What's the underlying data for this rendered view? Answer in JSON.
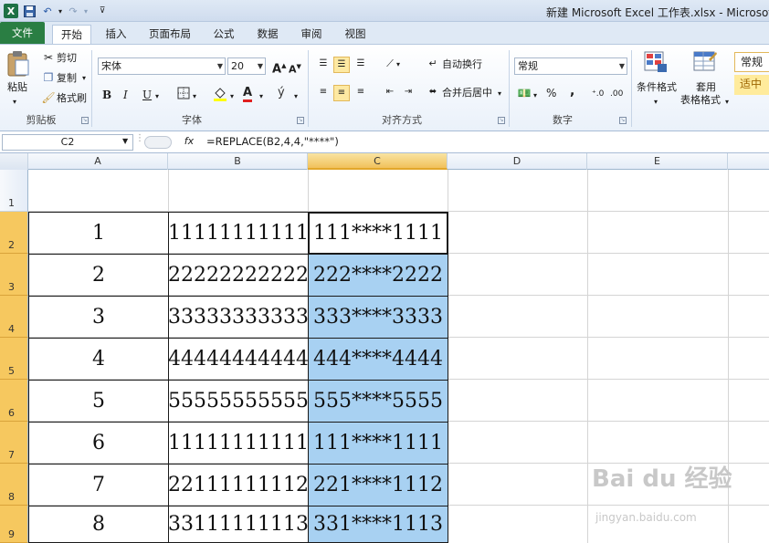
{
  "window": {
    "title": "新建 Microsoft Excel 工作表.xlsx - Microsoft"
  },
  "tabs": [
    {
      "label": "文件"
    },
    {
      "label": "开始"
    },
    {
      "label": "插入"
    },
    {
      "label": "页面布局"
    },
    {
      "label": "公式"
    },
    {
      "label": "数据"
    },
    {
      "label": "审阅"
    },
    {
      "label": "视图"
    }
  ],
  "ribbon": {
    "clipboard": {
      "paste": "粘贴",
      "cut": "剪切",
      "copy": "复制",
      "format_painter": "格式刷",
      "label": "剪贴板"
    },
    "font": {
      "name": "宋体",
      "size": "20",
      "bold": "B",
      "italic": "I",
      "underline": "U",
      "label": "字体",
      "font_color_glyph": "A",
      "grow": "A",
      "shrink": "A",
      "phonetic": "ý"
    },
    "alignment": {
      "wrap_text": "自动换行",
      "merge_center": "合并后居中",
      "label": "对齐方式"
    },
    "number": {
      "format": "常规",
      "percent": "%",
      "comma": ",",
      "label": "数字"
    },
    "styles": {
      "conditional": "条件格式",
      "table_format_1": "套用",
      "table_format_2": "表格格式",
      "normal": "常规",
      "neutral": "适中"
    }
  },
  "formula_bar": {
    "name_box": "C2",
    "fx": "fx",
    "formula": "=REPLACE(B2,4,4,\"****\")"
  },
  "columns": [
    "A",
    "B",
    "C",
    "D",
    "E"
  ],
  "rows": [
    {
      "num": "1",
      "a": "",
      "b": "",
      "c": ""
    },
    {
      "num": "2",
      "a": "1",
      "b": "11111111111",
      "c": "111****1111"
    },
    {
      "num": "3",
      "a": "2",
      "b": "22222222222",
      "c": "222****2222"
    },
    {
      "num": "4",
      "a": "3",
      "b": "33333333333",
      "c": "333****3333"
    },
    {
      "num": "5",
      "a": "4",
      "b": "44444444444",
      "c": "444****4444"
    },
    {
      "num": "6",
      "a": "5",
      "b": "55555555555",
      "c": "555****5555"
    },
    {
      "num": "7",
      "a": "6",
      "b": "11111111111",
      "c": "111****1111"
    },
    {
      "num": "8",
      "a": "7",
      "b": "22111111112",
      "c": "221****1112"
    },
    {
      "num": "9",
      "a": "8",
      "b": "33111111113",
      "c": "331****1113"
    }
  ],
  "watermark": {
    "main": "Bai du 经验",
    "sub": "jingyan.baidu.com"
  }
}
